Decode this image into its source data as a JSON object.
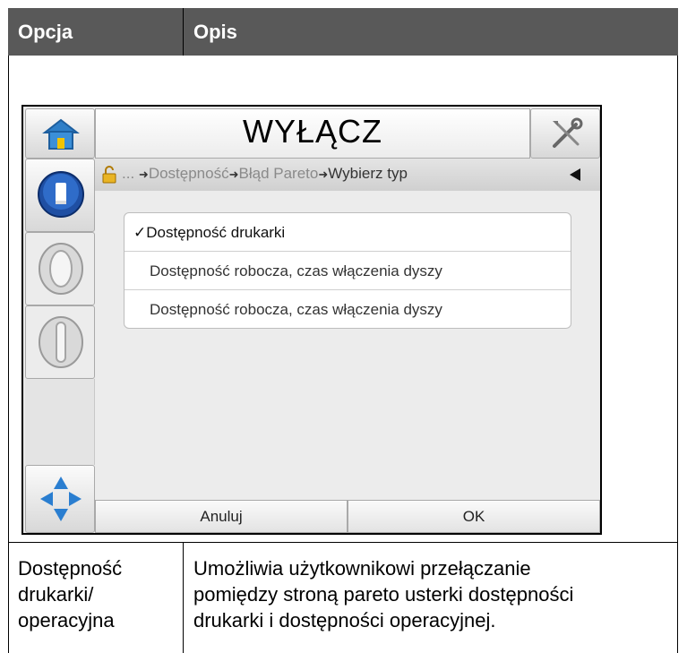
{
  "table": {
    "header": {
      "option": "Opcja",
      "description": "Opis"
    },
    "row": {
      "option_lines": [
        "Dostępność",
        "drukarki/",
        "operacyjna"
      ],
      "description_lines": [
        "Umożliwia użytkownikowi przełączanie",
        "pomiędzy stroną pareto usterki dostępności",
        "drukarki i dostępności operacyjnej."
      ]
    }
  },
  "screen": {
    "title": "WYŁĄCZ",
    "breadcrumb": {
      "ellipsis": "...",
      "items": [
        "Dostępność",
        "Błąd Pareto",
        "Wybierz typ"
      ],
      "arrow": "➜"
    },
    "options": [
      {
        "label": "Dostępność drukarki",
        "selected": true,
        "check": "✓"
      },
      {
        "label": "Dostępność robocza, czas włączenia dyszy",
        "selected": false,
        "check": ""
      },
      {
        "label": "Dostępność robocza, czas włączenia dyszy",
        "selected": false,
        "check": ""
      }
    ],
    "buttons": {
      "cancel": "Anuluj",
      "ok": "OK"
    },
    "icons": {
      "home": "home-icon",
      "tools": "tools-icon",
      "lock": "unlocked-padlock-icon",
      "back": "left-triangle-icon",
      "ink": "ink-cartridge-icon",
      "nozzle_1": "nozzle-icon",
      "nozzle_2": "nozzle-icon",
      "navigation": "navigation-arrows-icon"
    }
  }
}
